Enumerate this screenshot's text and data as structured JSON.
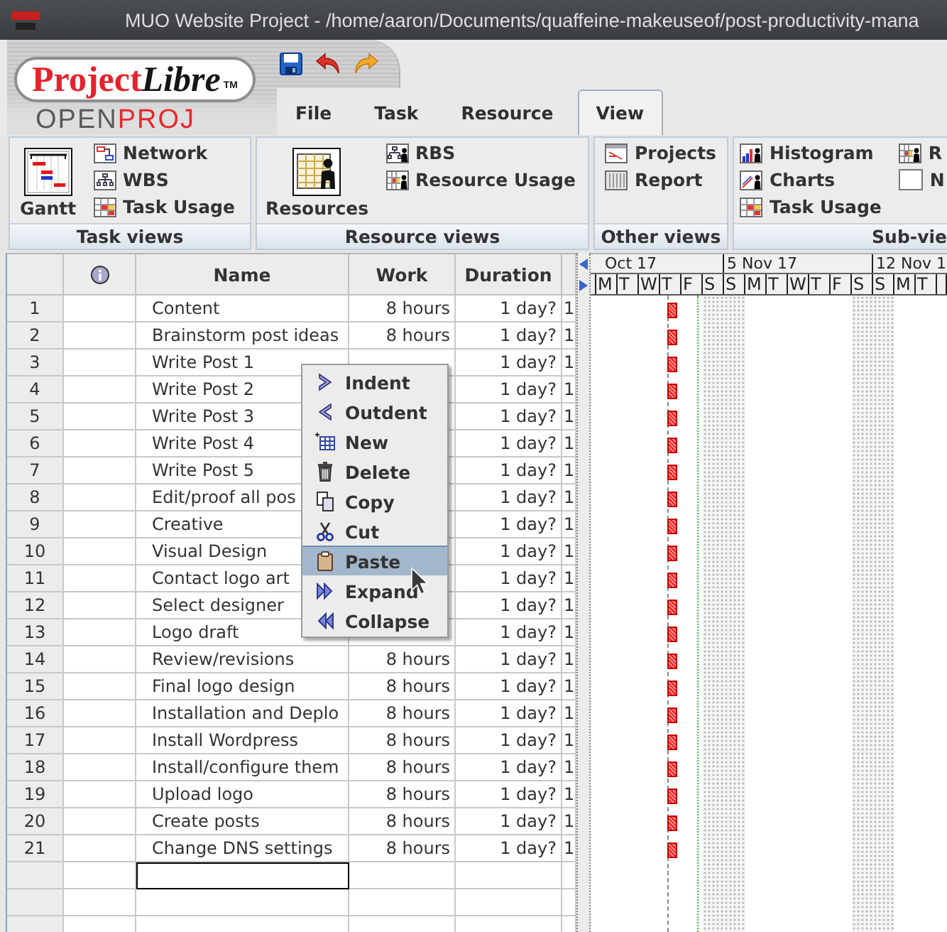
{
  "window": {
    "title": "MUO Website Project - /home/aaron/Documents/quaffeine-makeuseof/post-productivity-mana"
  },
  "logo": {
    "wordmark": [
      {
        "text": "Project",
        "color": "#e3232b"
      },
      {
        "text": "Libre",
        "color": "#161616"
      }
    ],
    "trademark": "TM",
    "subtitle": [
      {
        "text": "OPEN",
        "color": "#5a5a5a"
      },
      {
        "text": "PROJ",
        "color": "#e8262c"
      }
    ]
  },
  "tabs": [
    {
      "label": "File",
      "selected": false
    },
    {
      "label": "Task",
      "selected": false
    },
    {
      "label": "Resource",
      "selected": false
    },
    {
      "label": "View",
      "selected": true
    }
  ],
  "ribbon": {
    "groups": [
      {
        "label": "Task views",
        "large": {
          "label": "Gantt"
        },
        "columns": [
          [
            {
              "label": "Network"
            },
            {
              "label": "WBS"
            },
            {
              "label": "Task Usage"
            }
          ]
        ]
      },
      {
        "label": "Resource views",
        "large": {
          "label": "Resources"
        },
        "columns": [
          [
            {
              "label": "RBS"
            },
            {
              "label": "Resource Usage"
            }
          ]
        ]
      },
      {
        "label": "Other views",
        "columns": [
          [
            {
              "label": "Projects"
            },
            {
              "label": "Report"
            }
          ]
        ]
      },
      {
        "label": "Sub-vie",
        "columns": [
          [
            {
              "label": "Histogram"
            },
            {
              "label": "Charts"
            },
            {
              "label": "Task Usage"
            }
          ],
          [
            {
              "label": "R"
            },
            {
              "label": "N"
            }
          ]
        ]
      }
    ]
  },
  "table": {
    "headers": {
      "name": "Name",
      "work": "Work",
      "duration": "Duration"
    },
    "rows": [
      {
        "number": "1",
        "name": "Content",
        "work": "8 hours",
        "duration": "1 day?",
        "column_6": "1"
      },
      {
        "number": "2",
        "name": "Brainstorm post ideas",
        "work": "8 hours",
        "duration": "1 day?",
        "column_6": "1"
      },
      {
        "number": "3",
        "name": "Write Post 1",
        "duration": "1 day?",
        "column_6": "1"
      },
      {
        "number": "4",
        "name": "Write Post 2",
        "duration": "1 day?",
        "column_6": "1"
      },
      {
        "number": "5",
        "name": "Write Post 3",
        "duration": "1 day?",
        "column_6": "1"
      },
      {
        "number": "6",
        "name": "Write Post 4",
        "duration": "1 day?",
        "column_6": "1"
      },
      {
        "number": "7",
        "name": "Write Post 5",
        "duration": "1 day?",
        "column_6": "1"
      },
      {
        "number": "8",
        "name": "Edit/proof all pos",
        "duration": "1 day?",
        "column_6": "1"
      },
      {
        "number": "9",
        "name": "Creative",
        "duration": "1 day?",
        "column_6": "1"
      },
      {
        "number": "10",
        "name": "Visual Design",
        "duration": "1 day?",
        "column_6": "1"
      },
      {
        "number": "11",
        "name": "Contact logo art",
        "duration": "1 day?",
        "column_6": "1"
      },
      {
        "number": "12",
        "name": "Select designer",
        "duration": "1 day?",
        "column_6": "1"
      },
      {
        "number": "13",
        "name": "Logo draft",
        "duration": "1 day?",
        "column_6": "1"
      },
      {
        "number": "14",
        "name": "Review/revisions",
        "work": "8 hours",
        "duration": "1 day?",
        "column_6": "1"
      },
      {
        "number": "15",
        "name": "Final logo design",
        "work": "8 hours",
        "duration": "1 day?",
        "column_6": "1"
      },
      {
        "number": "16",
        "name": "Installation and Deplo",
        "work": "8 hours",
        "duration": "1 day?",
        "column_6": "1"
      },
      {
        "number": "17",
        "name": "Install Wordpress",
        "work": "8 hours",
        "duration": "1 day?",
        "column_6": "1"
      },
      {
        "number": "18",
        "name": "Install/configure them",
        "work": "8 hours",
        "duration": "1 day?",
        "column_6": "1"
      },
      {
        "number": "19",
        "name": "Upload logo",
        "work": "8 hours",
        "duration": "1 day?",
        "column_6": "1"
      },
      {
        "number": "20",
        "name": "Create posts",
        "work": "8 hours",
        "duration": "1 day?",
        "column_6": "1"
      },
      {
        "number": "21",
        "name": "Change DNS settings",
        "work": "8 hours",
        "duration": "1 day?",
        "column_6": "1"
      }
    ],
    "entry_row": {
      "selected": true
    }
  },
  "gantt": {
    "weeks": [
      "Oct 17",
      "5 Nov 17",
      "12 Nov 1"
    ],
    "days": [
      "M",
      "T",
      "W",
      "T",
      "F",
      "S",
      "S",
      "M",
      "T",
      "W",
      "T",
      "F",
      "S",
      "S",
      "M",
      "T"
    ]
  },
  "context_menu": {
    "items": [
      {
        "label": "Indent",
        "selected": false
      },
      {
        "label": "Outdent",
        "selected": false
      },
      {
        "label": "New",
        "selected": false
      },
      {
        "label": "Delete",
        "selected": false
      },
      {
        "label": "Copy",
        "selected": false
      },
      {
        "label": "Cut",
        "selected": false
      },
      {
        "label": "Paste",
        "selected": true
      },
      {
        "label": "Expand",
        "selected": false
      },
      {
        "label": "Collapse",
        "selected": false
      }
    ]
  }
}
